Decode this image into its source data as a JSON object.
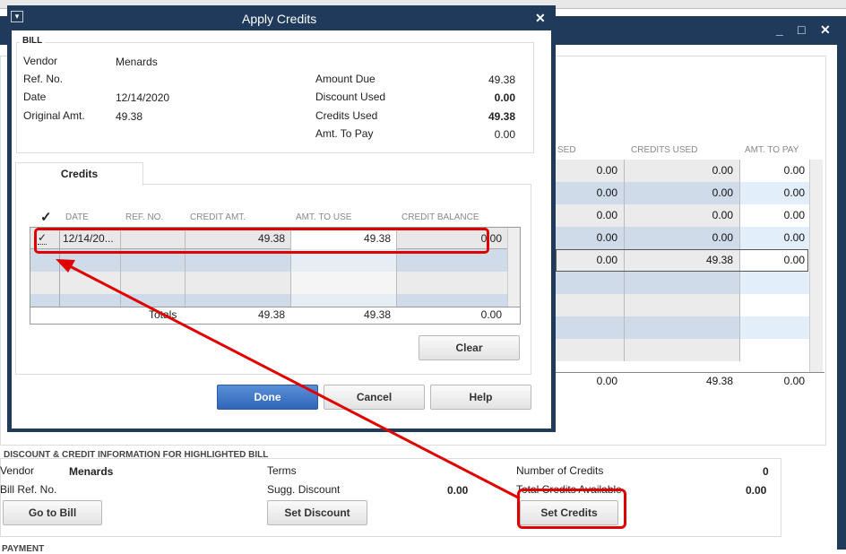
{
  "dialog": {
    "title": "Apply Credits",
    "close": "✕",
    "menu": "▾",
    "bill": {
      "section": "BILL",
      "vendor_label": "Vendor",
      "vendor": "Menards",
      "ref_label": "Ref. No.",
      "date_label": "Date",
      "date": "12/14/2020",
      "orig_label": "Original Amt.",
      "orig": "49.38",
      "amount_due_label": "Amount Due",
      "amount_due": "49.38",
      "discount_used_label": "Discount Used",
      "discount_used": "0.00",
      "credits_used_label": "Credits Used",
      "credits_used": "49.38",
      "amt_to_pay_label": "Amt. To Pay",
      "amt_to_pay": "0.00"
    },
    "tab": "Credits",
    "columns": [
      "✓",
      "DATE",
      "REF. NO.",
      "CREDIT AMT.",
      "AMT. TO USE",
      "CREDIT BALANCE"
    ],
    "rows": [
      {
        "check": "✓",
        "date": "12/14/20...",
        "ref": "",
        "credit_amt": "49.38",
        "amt_to_use": "49.38",
        "credit_balance": "0.00"
      }
    ],
    "totals": {
      "label": "Totals",
      "credit_amt": "49.38",
      "amt_to_use": "49.38",
      "credit_balance": "0.00"
    },
    "buttons": {
      "clear": "Clear",
      "done": "Done",
      "cancel": "Cancel",
      "help": "Help"
    }
  },
  "background": {
    "window_buttons": [
      "_",
      "□",
      "✕"
    ],
    "columns": [
      "SED",
      "CREDITS USED",
      "AMT. TO PAY"
    ],
    "rows": [
      [
        "0.00",
        "0.00",
        "0.00"
      ],
      [
        "0.00",
        "0.00",
        "0.00"
      ],
      [
        "0.00",
        "0.00",
        "0.00"
      ],
      [
        "0.00",
        "0.00",
        "0.00"
      ],
      [
        "0.00",
        "49.38",
        "0.00"
      ]
    ],
    "totals": [
      "0.00",
      "49.38",
      "0.00"
    ],
    "info": {
      "section": "DISCOUNT & CREDIT INFORMATION FOR HIGHLIGHTED BILL",
      "vendor_label": "Vendor",
      "vendor": "Menards",
      "ref_label": "Bill Ref. No.",
      "terms_label": "Terms",
      "sugg_label": "Sugg. Discount",
      "sugg": "0.00",
      "num_credits_label": "Number of Credits",
      "num_credits": "0",
      "total_credits_label": "Total Credits Available",
      "total_credits": "0.00",
      "go_to_bill": "Go to Bill",
      "set_discount": "Set Discount",
      "set_credits": "Set Credits"
    },
    "payment_section": "PAYMENT"
  },
  "colors": {
    "titlebar": "#1f3a5a",
    "annotation": "#e00000",
    "row_alt": "#cfdbe8"
  }
}
